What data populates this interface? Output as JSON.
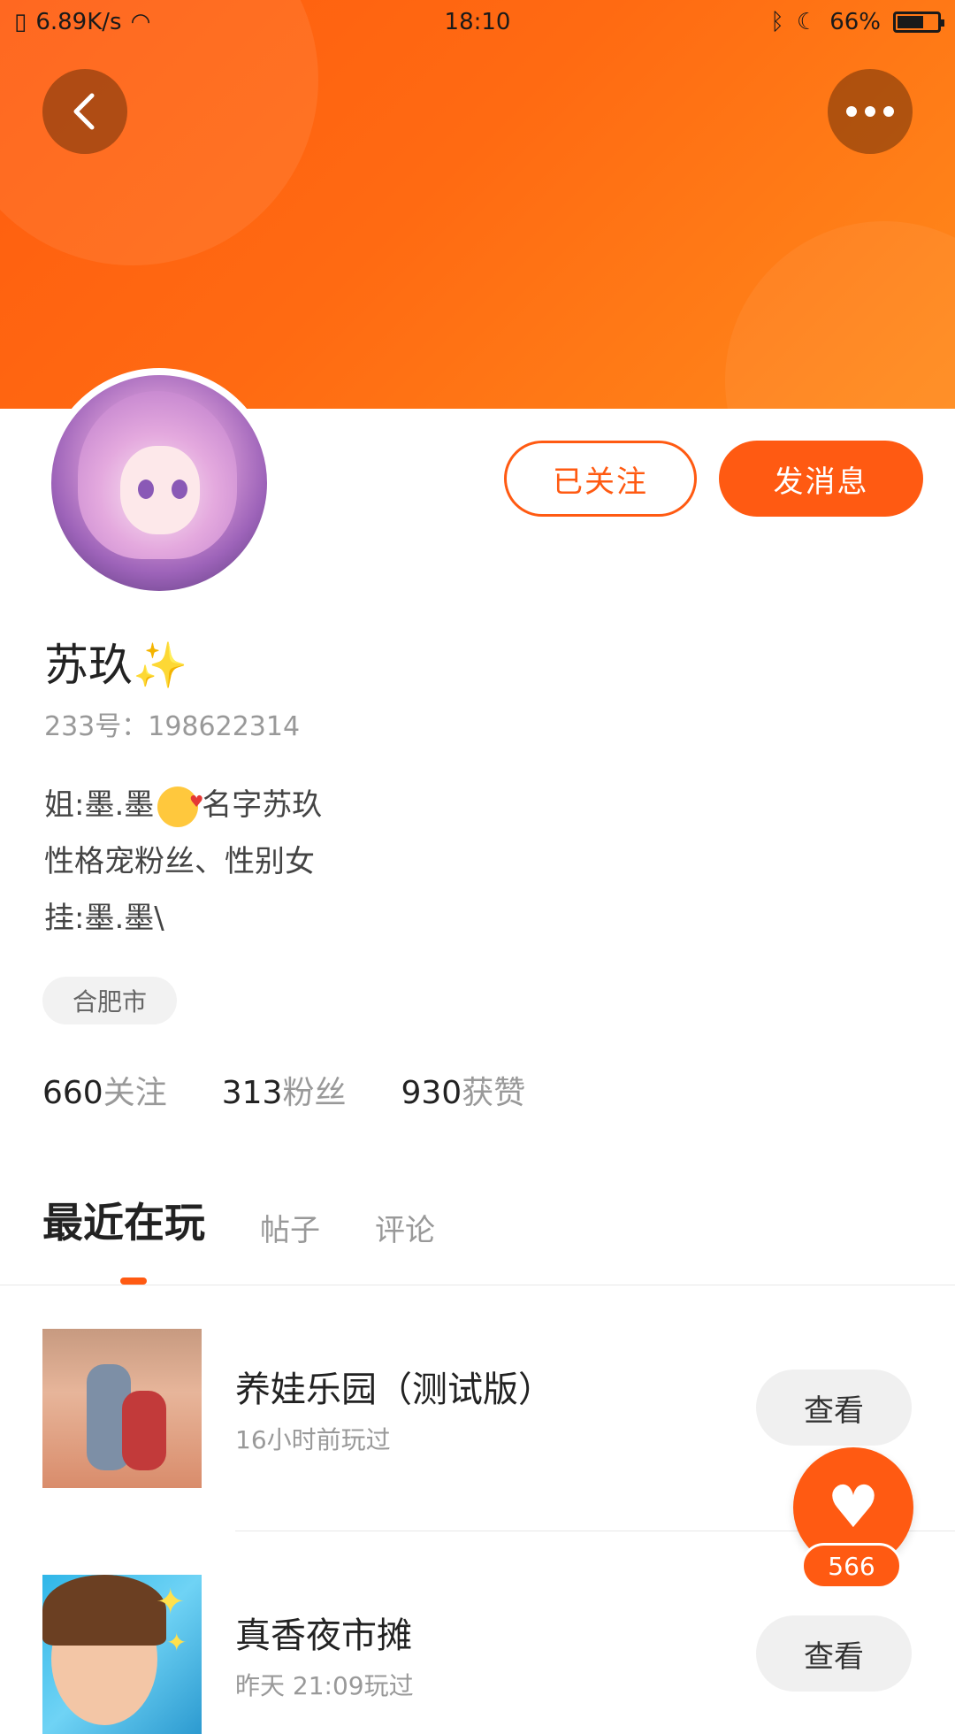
{
  "status_bar": {
    "net_speed": "6.89K/s",
    "time": "18:10",
    "battery": "66%",
    "battery_level": 0.66
  },
  "header": {
    "back_icon": "chevron-left-icon",
    "more_icon": "more-horizontal-icon"
  },
  "profile": {
    "name": "苏玖✨",
    "uid": "233号：198622314",
    "bio_line1_a": "姐:墨.墨",
    "bio_line1_b": "名字苏玖",
    "bio_line2": "性格宠粉丝、性别女",
    "bio_line3": "挂:墨.墨\\",
    "location": "合肥市",
    "followed_label": "已关注",
    "message_label": "发消息"
  },
  "stats": [
    {
      "num": "660",
      "label": "关注"
    },
    {
      "num": "313",
      "label": "粉丝"
    },
    {
      "num": "930",
      "label": "获赞"
    }
  ],
  "tabs": [
    {
      "label": "最近在玩",
      "active": true
    },
    {
      "label": "帖子",
      "active": false
    },
    {
      "label": "评论",
      "active": false
    }
  ],
  "games": [
    {
      "title": "养娃乐园（测试版）",
      "subtitle": "16小时前玩过",
      "action": "查看"
    },
    {
      "title": "真香夜市摊",
      "subtitle": "昨天 21:09玩过",
      "action": "查看"
    }
  ],
  "like": {
    "count": "566"
  },
  "colors": {
    "accent": "#ff5a12",
    "banner_start": "#ff5c0f",
    "banner_end": "#ff8a1b"
  }
}
